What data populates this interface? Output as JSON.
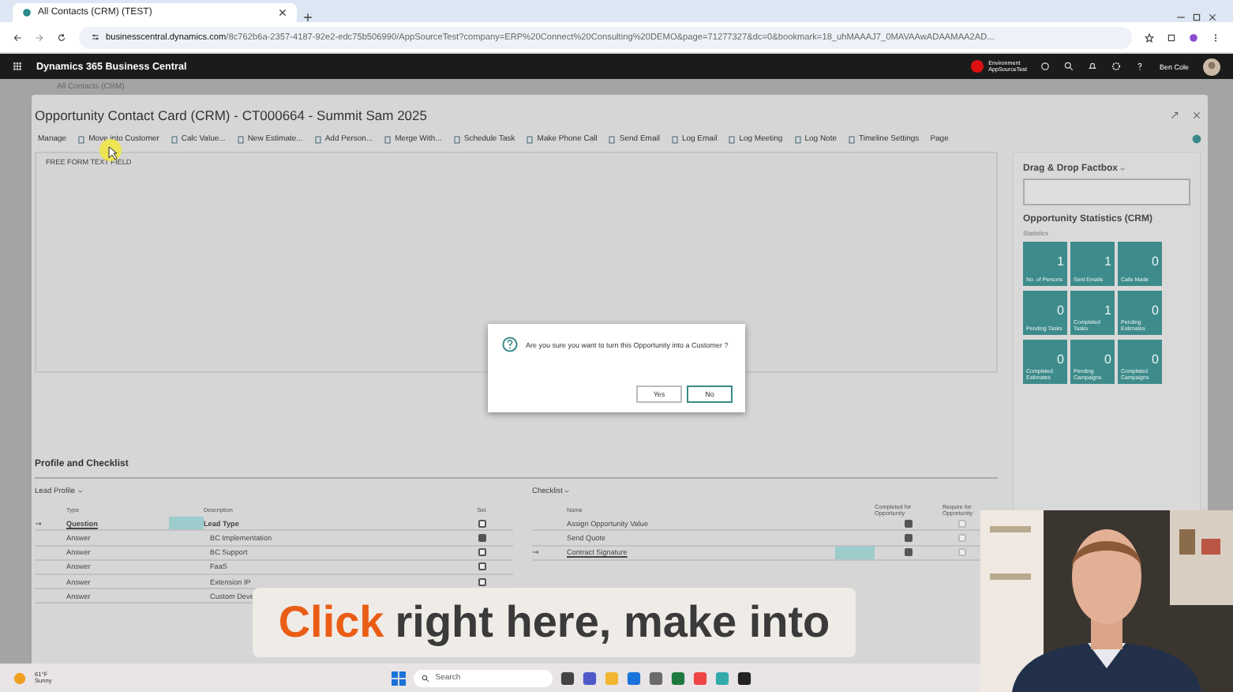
{
  "browser": {
    "tab_title": "All Contacts (CRM) (TEST)",
    "url_host": "businesscentral.dynamics.com",
    "url_path": "/8c762b6a-2357-4187-92e2-edc75b506990/AppSourceTest?company=ERP%20Connect%20Consulting%20DEMO&page=71277327&dc=0&bookmark=18_uhMAAAJ7_0MAVAAwADAAMAA2AD..."
  },
  "app_bar": {
    "title": "Dynamics 365 Business Central",
    "environment": "Environment",
    "environment_name": "AppSourceTest",
    "user": "Ben Cole"
  },
  "breadcrumb": "All Contacts (CRM)",
  "card": {
    "title": "Opportunity Contact Card (CRM) - CT000664 - Summit Sam 2025",
    "actions": [
      {
        "label": "Manage",
        "kind": "menu"
      },
      {
        "label": "Move into Customer",
        "kind": "action"
      },
      {
        "label": "Calc Value...",
        "kind": "action"
      },
      {
        "label": "New Estimate...",
        "kind": "action"
      },
      {
        "label": "Add Person...",
        "kind": "action"
      },
      {
        "label": "Merge With...",
        "kind": "action"
      },
      {
        "label": "Schedule Task",
        "kind": "action"
      },
      {
        "label": "Make Phone Call",
        "kind": "action"
      },
      {
        "label": "Send Email",
        "kind": "action"
      },
      {
        "label": "Log Email",
        "kind": "action"
      },
      {
        "label": "Log Meeting",
        "kind": "action"
      },
      {
        "label": "Log Note",
        "kind": "action"
      },
      {
        "label": "Timeline Settings",
        "kind": "action"
      },
      {
        "label": "Page",
        "kind": "menu"
      }
    ],
    "free_text_label": "FREE FORM TEXT FIELD",
    "section_title": "Profile and Checklist",
    "lead_profile": {
      "title": "Lead Profile",
      "columns": [
        "Type",
        "Description",
        "Set"
      ],
      "rows": [
        {
          "type": "Question",
          "description": "Lead Type",
          "set": false,
          "current": true,
          "kind": "question"
        },
        {
          "type": "Answer",
          "description": "BC Implementation",
          "set": true,
          "current": false,
          "kind": "answer"
        },
        {
          "type": "Answer",
          "description": "BC Support",
          "set": false,
          "current": false,
          "kind": "answer"
        },
        {
          "type": "Answer",
          "description": "FaaS",
          "set": false,
          "current": false,
          "kind": "answer"
        },
        {
          "type": "Answer",
          "description": "Extension IP",
          "set": false,
          "current": false,
          "kind": "answer"
        },
        {
          "type": "Answer",
          "description": "Custom Deve",
          "current": false,
          "kind": "answer"
        }
      ]
    },
    "checklist": {
      "title": "Checklist",
      "columns": [
        "Name",
        "Completed for Opportunity",
        "Require for Opportunity"
      ],
      "rows": [
        {
          "name": "Assign Opportunity Value",
          "completed": true,
          "required": false,
          "current": false
        },
        {
          "name": "Send Quote",
          "completed": true,
          "required": false,
          "current": false
        },
        {
          "name": "Contract Signature",
          "completed": true,
          "required": false,
          "current": true
        }
      ]
    }
  },
  "factbox": {
    "title": "Drag & Drop Factbox",
    "stats_title": "Opportunity Statistics (CRM)",
    "stats_subtitle": "Statistics",
    "tiles": [
      {
        "value": "1",
        "label": "No. of Persons"
      },
      {
        "value": "1",
        "label": "Sent Emails"
      },
      {
        "value": "0",
        "label": "Calls Made"
      },
      {
        "value": "0",
        "label": "Pending Tasks"
      },
      {
        "value": "1",
        "label": "Completed Tasks"
      },
      {
        "value": "0",
        "label": "Pending Estimates"
      },
      {
        "value": "0",
        "label": "Completed Estimates"
      },
      {
        "value": "0",
        "label": "Pending Campaigns"
      },
      {
        "value": "0",
        "label": "Completed Campaigns"
      }
    ]
  },
  "dialog": {
    "message": "Are you sure you want to turn this Opportunity into a Customer ?",
    "buttons": [
      {
        "label": "Yes",
        "focused": false
      },
      {
        "label": "No",
        "focused": true
      }
    ]
  },
  "caption": {
    "highlight": "Click",
    "text": "right here, make into"
  },
  "taskbar": {
    "temperature": "61°F",
    "weather": "Sunny",
    "search_placeholder": "Search"
  }
}
